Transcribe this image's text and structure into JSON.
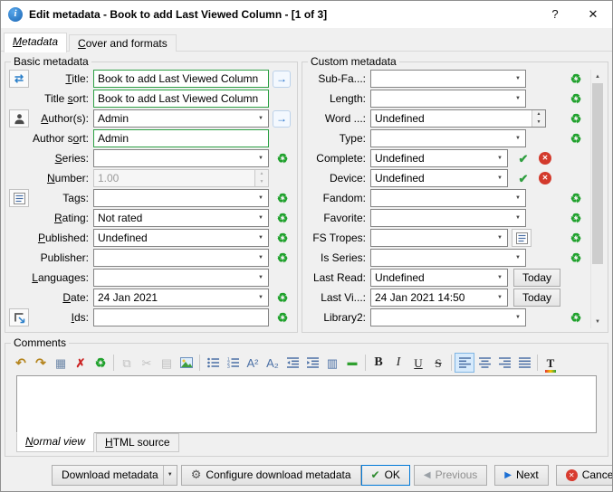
{
  "window": {
    "title": "Edit metadata - Book to add Last Viewed Column -  [1 of 3]",
    "help": "?",
    "close": "✕"
  },
  "tabs": {
    "metadata": "<u>M</u>etadata",
    "cover": "<u>C</u>over and formats"
  },
  "icons": {
    "info": "i",
    "clear": "♻",
    "check": "✔",
    "cross": "✕",
    "gear": "⚙",
    "dropdown": "▼",
    "spin_up": "▲",
    "spin_down": "▼",
    "swap": "⇄",
    "auto_arrow": "→",
    "undo": "↶",
    "redo": "↷",
    "select_all": "▦",
    "remove_format": "✗",
    "copy": "⧉",
    "cut": "✂",
    "paste": "▤",
    "superscript": "A²",
    "subscript": "A₂",
    "table": "▥",
    "hr": "▬",
    "bold": "B",
    "italic": "I",
    "underline": "U",
    "strike": "S",
    "text_color": "T",
    "prev_arrow": "◀",
    "next_arrow": "▶",
    "scroll_up": "▲",
    "scroll_down": "▼"
  },
  "basic": {
    "title": "Basic metadata",
    "rows": {
      "title": {
        "label": "<u>T</u>itle:",
        "value": "Book to add Last Viewed Column"
      },
      "title_sort": {
        "label": "Title <u>s</u>ort:",
        "value": "Book to add Last Viewed Column"
      },
      "authors": {
        "label": "<u>A</u>uthor(s):",
        "value": "Admin"
      },
      "author_sort": {
        "label": "Author s<u>o</u>rt:",
        "value": "Admin"
      },
      "series": {
        "label": "<u>S</u>eries:",
        "value": ""
      },
      "number": {
        "label": "<u>N</u>umber:",
        "value": "1.00"
      },
      "tags": {
        "label": "Ta<u>g</u>s:",
        "value": ""
      },
      "rating": {
        "label": "<u>R</u>ating:",
        "value": "Not rated"
      },
      "published": {
        "label": "<u>P</u>ublished:",
        "value": "Undefined"
      },
      "publisher": {
        "label": "Publisher:",
        "value": ""
      },
      "languages": {
        "label": "<u>L</u>anguages:",
        "value": ""
      },
      "date": {
        "label": "<u>D</u>ate:",
        "value": "24 Jan 2021"
      },
      "ids": {
        "label": "<u>I</u>ds:",
        "value": ""
      }
    }
  },
  "custom": {
    "title": "Custom metadata",
    "today_label": "Today",
    "rows": [
      {
        "label": "Sub-Fa...:",
        "value": ""
      },
      {
        "label": "Length:",
        "value": ""
      },
      {
        "label": "Word ...:",
        "value": "Undefined"
      },
      {
        "label": "Type:",
        "value": ""
      },
      {
        "label": "Complete:",
        "value": "Undefined"
      },
      {
        "label": "Device:",
        "value": "Undefined"
      },
      {
        "label": "Fandom:",
        "value": ""
      },
      {
        "label": "Favorite:",
        "value": ""
      },
      {
        "label": "FS Tropes:",
        "value": ""
      },
      {
        "label": "Is Series:",
        "value": ""
      },
      {
        "label": "Last Read:",
        "value": "Undefined"
      },
      {
        "label": "Last Vi...:",
        "value": "24 Jan 2021 14:50"
      },
      {
        "label": "Library2:",
        "value": ""
      }
    ]
  },
  "comments": {
    "title": "Comments",
    "text": "",
    "view_tabs": {
      "normal": "<u>N</u>ormal view",
      "html": "<u>H</u>TML source"
    }
  },
  "buttons": {
    "download": "Download metadata",
    "configure": "Configure download metadata",
    "ok": "OK",
    "previous": "Previous",
    "next": "Next",
    "cancel": "Cancel"
  },
  "colors": {
    "changed_field_border": "#2da044",
    "accent_green": "#1fa12c",
    "accent_red": "#d33a2c",
    "accent_blue": "#1b6ac9",
    "default_button_border": "#0078d7"
  }
}
